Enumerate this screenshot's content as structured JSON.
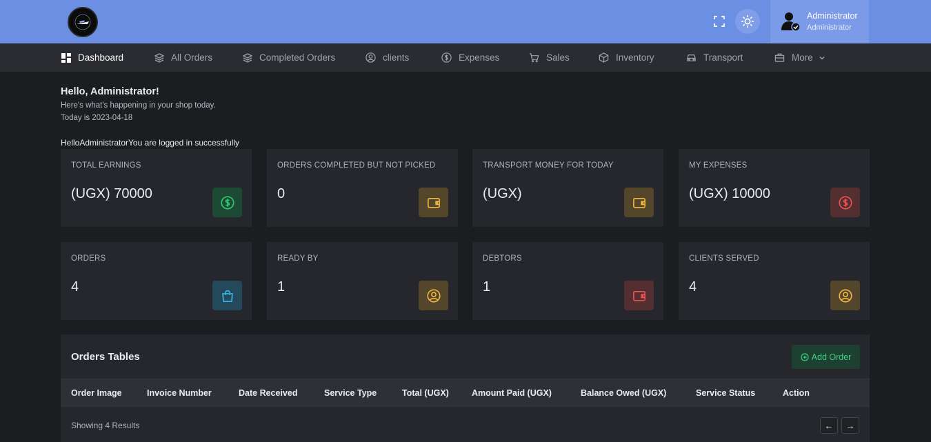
{
  "header": {
    "user_name": "Administrator",
    "user_role": "Administrator"
  },
  "nav": {
    "items": [
      {
        "label": "Dashboard",
        "icon": "dashboard-icon"
      },
      {
        "label": "All Orders",
        "icon": "layers-icon"
      },
      {
        "label": "Completed Orders",
        "icon": "layers-icon"
      },
      {
        "label": "clients",
        "icon": "user-circle-icon"
      },
      {
        "label": "Expenses",
        "icon": "dollar-circle-icon"
      },
      {
        "label": "Sales",
        "icon": "cart-icon"
      },
      {
        "label": "Inventory",
        "icon": "box-icon"
      },
      {
        "label": "Transport",
        "icon": "car-icon"
      },
      {
        "label": "More",
        "icon": "briefcase-icon"
      }
    ]
  },
  "greeting": {
    "title": "Hello, Administrator!",
    "subtitle": "Here's what's happening in your shop today.",
    "date_line": "Today is 2023-04-18",
    "login_message": "HelloAdministratorYou are logged in successfully"
  },
  "stats": [
    {
      "label": "TOTAL EARNINGS",
      "value": "(UGX) 70000",
      "icon": "dollar-circle-icon",
      "color": "#2ecc71"
    },
    {
      "label": "ORDERS COMPLETED BUT NOT PICKED",
      "value": "0",
      "icon": "wallet-icon",
      "color": "#f4b740"
    },
    {
      "label": "TRANSPORT MONEY FOR TODAY",
      "value": "(UGX)",
      "icon": "wallet-icon",
      "color": "#f4b740"
    },
    {
      "label": "MY EXPENSES",
      "value": "(UGX) 10000",
      "icon": "dollar-circle-icon",
      "color": "#ef5350"
    },
    {
      "label": "ORDERS",
      "value": "4",
      "icon": "shopping-bag-icon",
      "color": "#3ab7e8"
    },
    {
      "label": "READY BY",
      "value": "1",
      "icon": "user-circle-icon",
      "color": "#f4b740"
    },
    {
      "label": "DEBTORS",
      "value": "1",
      "icon": "wallet-icon",
      "color": "#ef5350"
    },
    {
      "label": "CLIENTS SERVED",
      "value": "4",
      "icon": "user-circle-icon",
      "color": "#f4b740"
    }
  ],
  "orders_table": {
    "title": "Orders Tables",
    "add_button": "Add Order",
    "columns": [
      "Order Image",
      "Invoice Number",
      "Date Received",
      "Service Type",
      "Total (UGX)",
      "Amount Paid (UGX)",
      "Balance Owed (UGX)",
      "Service Status",
      "Action"
    ],
    "showing_text": "Showing 4 Results",
    "prev_label": "←",
    "next_label": "→"
  },
  "colors": {
    "header_bg": "#6a8fe3",
    "page_bg": "#1b1d21",
    "card_bg": "#25272c",
    "accent_green": "#2ecc71"
  }
}
